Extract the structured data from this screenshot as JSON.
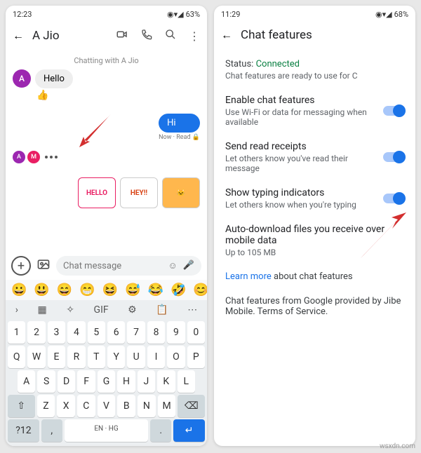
{
  "left": {
    "status": {
      "time": "12:23",
      "battery": "63%"
    },
    "header": {
      "name": "A Jio"
    },
    "sys": "Chatting with A Jio",
    "incoming": "Hello",
    "thumbs": "👍",
    "outgoing": "Hi",
    "meta": "Now · Read 🔒",
    "stickers": [
      "HELLO",
      "HEY!!",
      "🐱"
    ],
    "input_placeholder": "Chat message",
    "emoji": [
      "😀",
      "😃",
      "😄",
      "😁",
      "😆",
      "😅",
      "😂",
      "🤣",
      "😊"
    ],
    "kb": {
      "nums": [
        "1",
        "2",
        "3",
        "4",
        "5",
        "6",
        "7",
        "8",
        "9",
        "0"
      ],
      "r1": [
        "Q",
        "W",
        "E",
        "R",
        "T",
        "Y",
        "U",
        "I",
        "O",
        "P"
      ],
      "r2": [
        "A",
        "S",
        "D",
        "F",
        "G",
        "H",
        "J",
        "K",
        "L"
      ],
      "r3": [
        "Z",
        "X",
        "C",
        "V",
        "B",
        "N",
        "M"
      ],
      "shift": "⇧",
      "back": "⌫",
      "sym": "?12",
      "comma": ",",
      "lang": "EN · HG",
      "period": ".",
      "enter": "↵"
    }
  },
  "right": {
    "status": {
      "time": "11:29",
      "battery": "68%"
    },
    "title": "Chat features",
    "status_label": "Status:",
    "status_value": "Connected",
    "status_sub": "Chat features are ready to use for C",
    "items": [
      {
        "t": "Enable chat features",
        "s": "Use Wi-Fi or data for messaging when available",
        "toggle": true
      },
      {
        "t": "Send read receipts",
        "s": "Let others know you've read their message",
        "toggle": true
      },
      {
        "t": "Show typing indicators",
        "s": "Let others know when you're typing",
        "toggle": true
      },
      {
        "t": "Auto-download files you receive over mobile data",
        "s": "Up to 105 MB",
        "toggle": false
      }
    ],
    "learn": "Learn more",
    "learn_after": " about chat features",
    "footer": "Chat features from Google provided by Jibe Mobile. Terms of Service."
  },
  "watermark": "wsxdn.com"
}
